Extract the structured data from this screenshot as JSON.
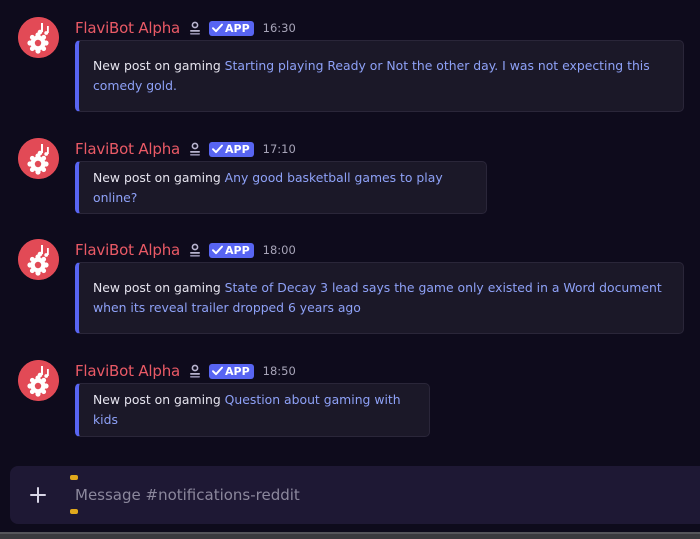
{
  "colors": {
    "background": "#0e0b1c",
    "username": "#ea5a66",
    "link": "#8ea1f7",
    "embed_accent": "#5865f2",
    "app_badge": "#5865f2",
    "avatar": "#e24a56",
    "composer": "#1e1834"
  },
  "messages": [
    {
      "username": "FlaviBot Alpha",
      "badge": "APP",
      "time": "16:30",
      "prefix": "New post on gaming ",
      "link": "Starting playing Ready or Not the other day. I was not expecting this comedy gold."
    },
    {
      "username": "FlaviBot Alpha",
      "badge": "APP",
      "time": "17:10",
      "prefix": "New post on gaming ",
      "link": "Any good basketball games to play online?"
    },
    {
      "username": "FlaviBot Alpha",
      "badge": "APP",
      "time": "18:00",
      "prefix": "New post on gaming ",
      "link": "State of Decay 3 lead says the game only existed in a Word document when its reveal trailer dropped 6 years ago"
    },
    {
      "username": "FlaviBot Alpha",
      "badge": "APP",
      "time": "18:50",
      "prefix": "New post on gaming ",
      "link": "Question about gaming with kids"
    }
  ],
  "composer": {
    "placeholder": "Message #notifications-reddit"
  },
  "icons": {
    "avatar": "bot-avatar-icon",
    "role": "role-badge-icon",
    "check": "check-icon",
    "add": "plus-icon"
  }
}
